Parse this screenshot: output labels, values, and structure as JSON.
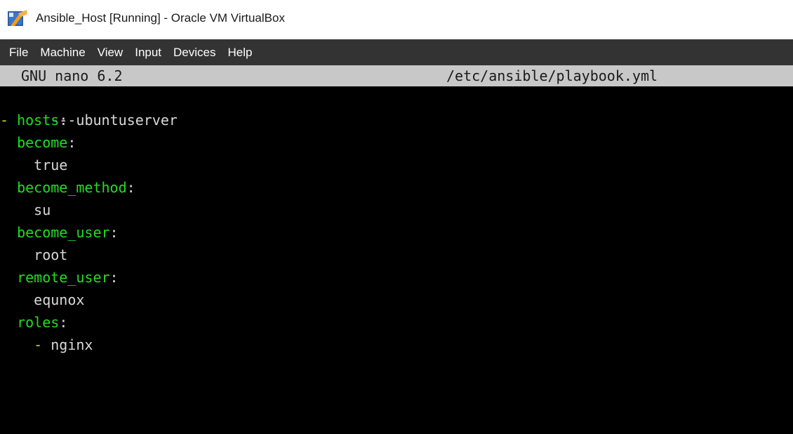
{
  "window": {
    "title": "Ansible_Host [Running] - Oracle VM VirtualBox"
  },
  "menubar": {
    "items": [
      {
        "label": "File"
      },
      {
        "label": "Machine"
      },
      {
        "label": "View"
      },
      {
        "label": "Input"
      },
      {
        "label": "Devices"
      },
      {
        "label": "Help"
      }
    ]
  },
  "nano": {
    "version": "GNU nano 6.2",
    "filename": "/etc/ansible/playbook.yml"
  },
  "editor": {
    "doc_start": "---",
    "list_dash": "-",
    "colon": ":",
    "hosts_key": "hosts",
    "hosts_value": "ubuntuserver",
    "become_key": "become",
    "become_value": "true",
    "become_method_key": "become_method",
    "become_method_value": "su",
    "become_user_key": "become_user",
    "become_user_value": "root",
    "remote_user_key": "remote_user",
    "remote_user_value": "equnox",
    "roles_key": "roles",
    "roles_item_dash": "-",
    "roles_item_value": "nginx"
  },
  "colors": {
    "key": "#22dd22",
    "text": "#d8d8d8",
    "dash": "#d4d400",
    "header_bg": "#c8c8c8",
    "menubar_bg": "#333333",
    "screen_bg": "#000000"
  },
  "icons": {
    "app": "virtualbox-icon"
  }
}
